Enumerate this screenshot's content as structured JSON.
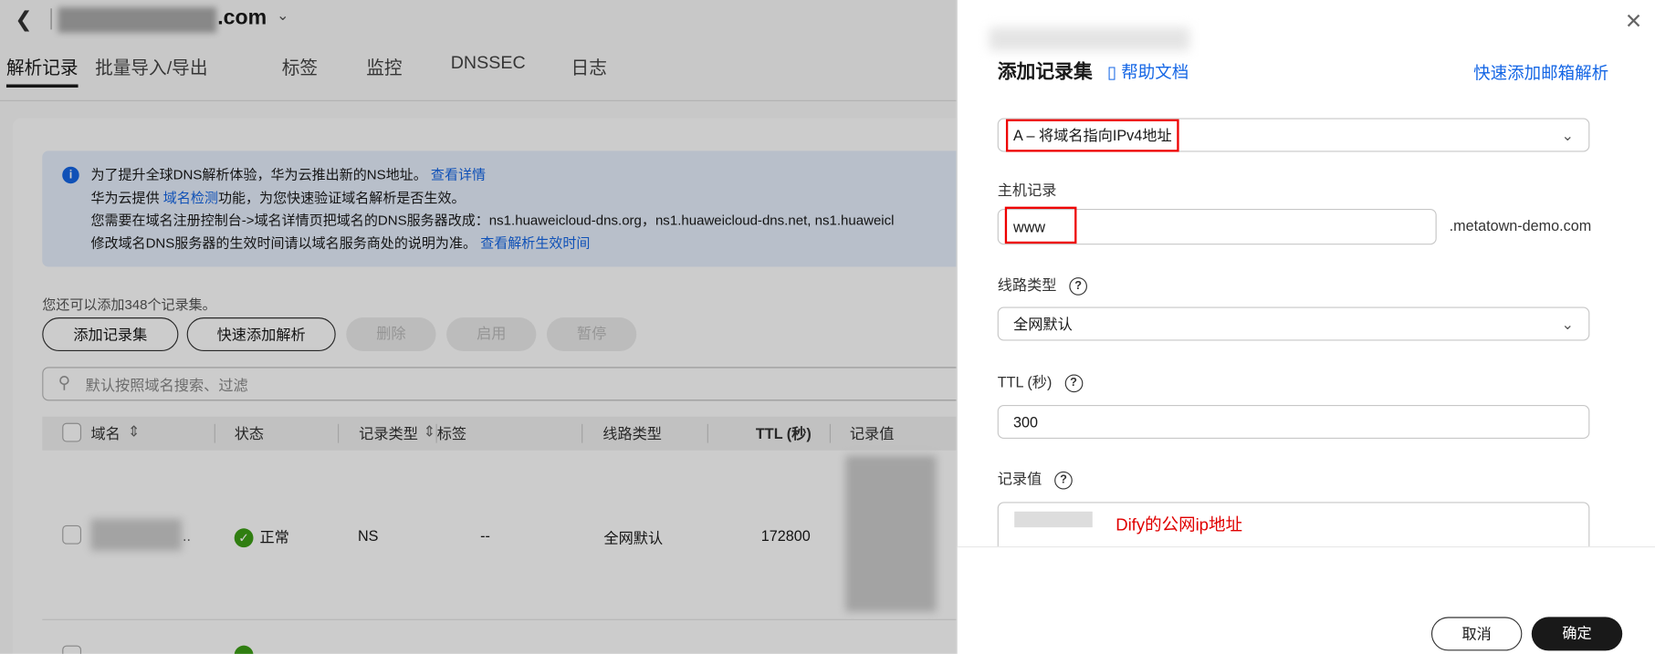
{
  "header": {
    "back_icon": "chevron-left-icon",
    "domain_suffix": ".com",
    "domain_chevron": "chevron-down-icon"
  },
  "tabs": [
    {
      "label": "解析记录"
    },
    {
      "label": "批量导入/导出"
    },
    {
      "label": "标签"
    },
    {
      "label": "监控"
    },
    {
      "label": "DNSSEC"
    },
    {
      "label": "日志"
    }
  ],
  "info": {
    "line1": "为了提升全球DNS解析体验，华为云推出新的NS地址。",
    "link1": "查看详情",
    "line2a": "华为云提供 ",
    "link2": "域名检测",
    "line2b": "功能，为您快速验证域名解析是否生效。",
    "line3": "您需要在域名注册控制台->域名详情页把域名的DNS服务器改成：ns1.huaweicloud-dns.org，ns1.huaweicloud-dns.net, ns1.huaweicl",
    "line4": "修改域名DNS服务器的生效时间请以域名服务商处的说明为准。",
    "link4": "查看解析生效时间"
  },
  "note": "您还可以添加348个记录集。",
  "toolbar": {
    "add": "添加记录集",
    "quick": "快速添加解析",
    "delete": "删除",
    "enable": "启用",
    "pause": "暂停"
  },
  "search": {
    "placeholder": "默认按照域名搜索、过滤"
  },
  "table": {
    "headers": [
      "域名",
      "状态",
      "记录类型",
      "标签",
      "线路类型",
      "TTL (秒)",
      "记录值"
    ],
    "rows": [
      {
        "status": "正常",
        "type": "NS",
        "tag": "--",
        "line": "全网默认",
        "ttl": "172800"
      }
    ]
  },
  "panel": {
    "title": "添加记录集",
    "help": "帮助文档",
    "quick_mail": "快速添加邮箱解析",
    "type_value": "A – 将域名指向IPv4地址",
    "host_label": "主机记录",
    "host_value": "www",
    "host_suffix": ".metatown-demo.com",
    "line_label": "线路类型",
    "line_value": "全网默认",
    "ttl_label": "TTL (秒)",
    "ttl_value": "300",
    "value_label": "记录值",
    "value_annotation": "Dify的公网ip地址",
    "cancel": "取消",
    "confirm": "确定"
  },
  "colors": {
    "link": "#1466e5",
    "annotation": "#e00000",
    "primary_button": "#191919"
  }
}
